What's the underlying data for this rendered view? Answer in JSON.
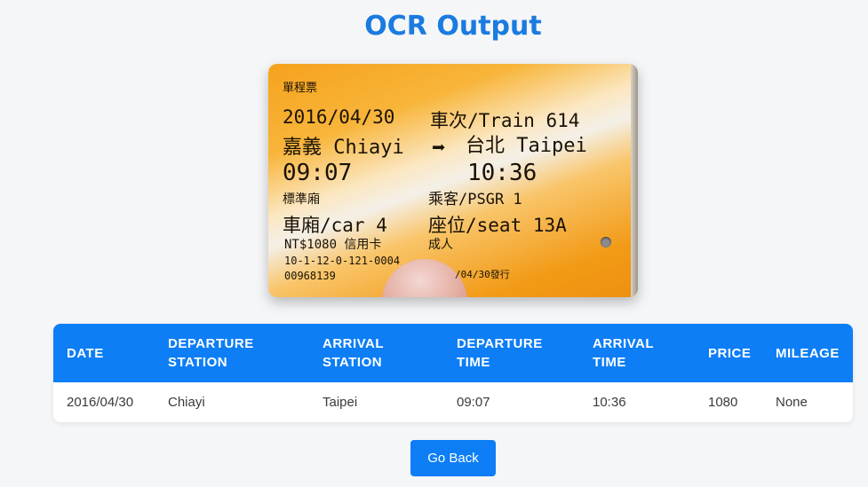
{
  "page": {
    "title": "OCR Output"
  },
  "ticket": {
    "label": "單程票",
    "date": "2016/04/30",
    "train": "車次/Train 614",
    "from": "嘉義 Chiayi",
    "arrow": "➡",
    "to": "台北 Taipei",
    "departure": "09:07",
    "arrival": "10:36",
    "class": "標準廂",
    "passenger": "乘客/PSGR 1",
    "car": "車廂/car 4",
    "seat": "座位/seat 13A",
    "fare": "NT$1080 信用卡",
    "type": "成人",
    "code": "10-1-12-0-121-0004",
    "serial": "00968139",
    "issued": "/04/30發行"
  },
  "table": {
    "headers": [
      "DATE",
      "DEPARTURE\nSTATION",
      "ARRIVAL\nSTATION",
      "DEPARTURE\nTIME",
      "ARRIVAL\nTIME",
      "PRICE",
      "MILEAGE"
    ],
    "row": [
      "2016/04/30",
      "Chiayi",
      "Taipei",
      "09:07",
      "10:36",
      "1080",
      "None"
    ]
  },
  "actions": {
    "back_label": "Go Back"
  }
}
